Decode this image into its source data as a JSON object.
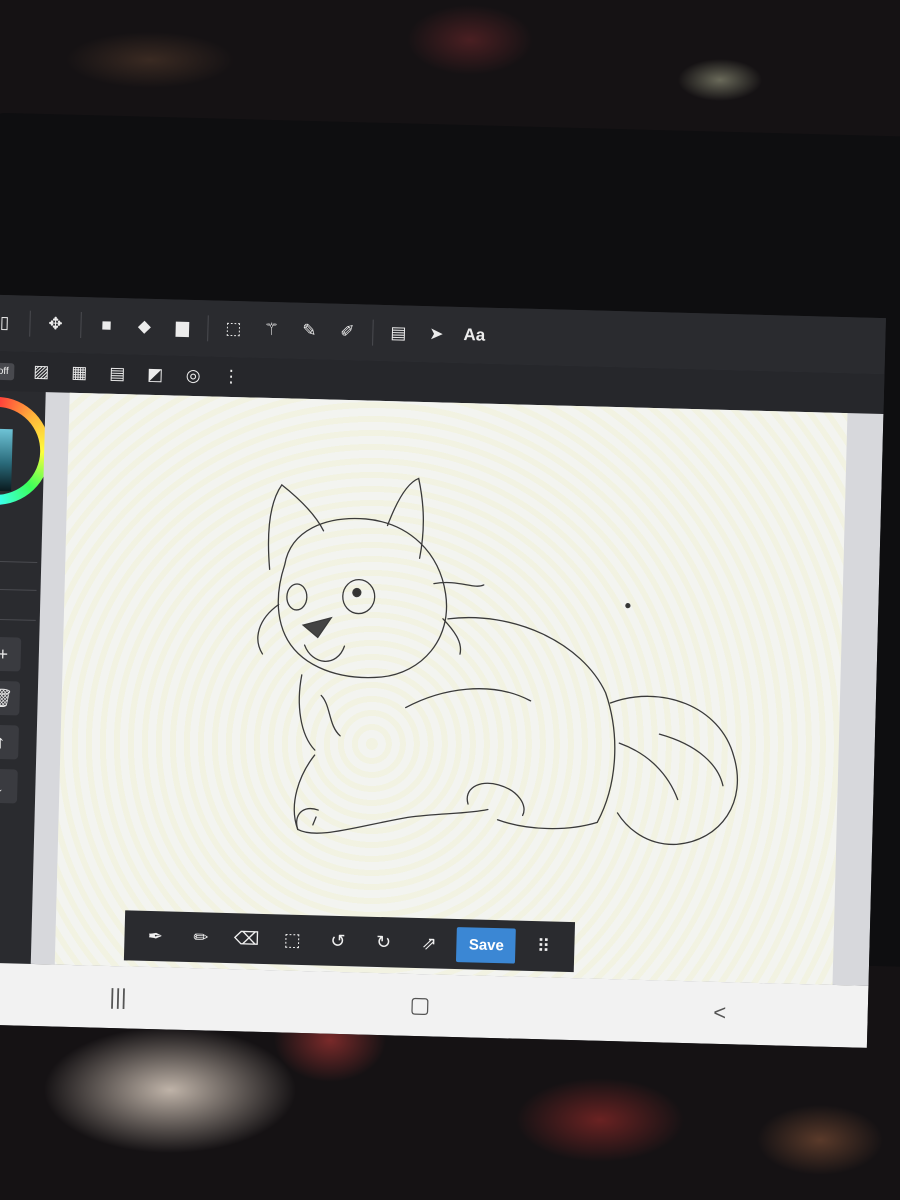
{
  "toolbar": {
    "row1": [
      {
        "name": "shape-rect-icon",
        "glyph": "▯"
      },
      {
        "name": "transform-move-icon",
        "glyph": "✥"
      },
      {
        "name": "fill-color-icon",
        "glyph": "■"
      },
      {
        "name": "paint-bucket-icon",
        "glyph": "◆"
      },
      {
        "name": "gradient-icon",
        "glyph": "▆"
      },
      {
        "name": "rect-select-icon",
        "glyph": "⬚"
      },
      {
        "name": "magic-wand-icon",
        "glyph": "⚚"
      },
      {
        "name": "select-pen-icon",
        "glyph": "✎"
      },
      {
        "name": "select-eraser-icon",
        "glyph": "✐"
      },
      {
        "name": "layer-panel-icon",
        "glyph": "▤"
      },
      {
        "name": "pointer-icon",
        "glyph": "➤"
      }
    ],
    "text_tool_label": "Aa",
    "off_label": "off",
    "row2": [
      {
        "name": "hatch-diagonal-icon",
        "glyph": "▨"
      },
      {
        "name": "grid-icon",
        "glyph": "▦"
      },
      {
        "name": "hatch-horizontal-icon",
        "glyph": "▤"
      },
      {
        "name": "perspective-icon",
        "glyph": "◩"
      },
      {
        "name": "concentric-icon",
        "glyph": "◎"
      },
      {
        "name": "more-vertical-icon",
        "glyph": "⋮"
      }
    ]
  },
  "layers_panel": {
    "add_glyph": "+",
    "delete_glyph": "🗑",
    "up_glyph": "↑",
    "down_glyph": "↓"
  },
  "bottom_bar": {
    "tools": [
      {
        "name": "eyedropper-icon",
        "glyph": "✒"
      },
      {
        "name": "pencil-icon",
        "glyph": "✏"
      },
      {
        "name": "eraser-icon",
        "glyph": "⌫"
      },
      {
        "name": "deselect-icon",
        "glyph": "⬚"
      },
      {
        "name": "undo-icon",
        "glyph": "↺"
      },
      {
        "name": "redo-icon",
        "glyph": "↻"
      },
      {
        "name": "export-icon",
        "glyph": "⇗"
      }
    ],
    "save_label": "Save",
    "menu_glyph": "⠿"
  },
  "nav": {
    "recents_glyph": "|||",
    "home_glyph": "▢",
    "back_glyph": "<"
  },
  "colors": {
    "accent": "#3b87d4",
    "toolbar_bg": "#2a2b2f",
    "canvas_bg": "#f3f4f0"
  }
}
